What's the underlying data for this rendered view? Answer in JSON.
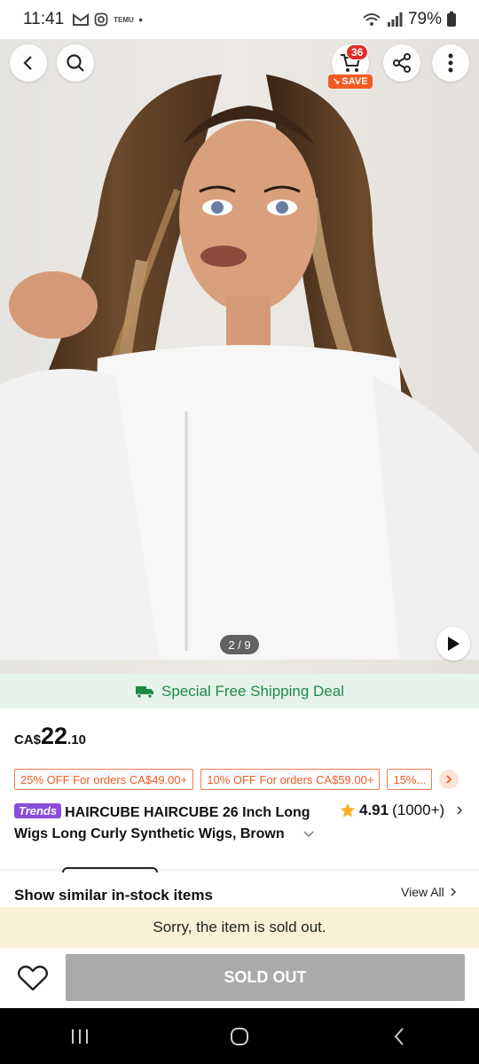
{
  "status_bar": {
    "time": "11:41",
    "battery": "79%",
    "notif_icons": [
      "gmail-icon",
      "instagram-icon",
      "temu-icon"
    ],
    "temu_label": "TEMU"
  },
  "header": {
    "cart_count": "36",
    "save_label": "SAVE"
  },
  "gallery": {
    "page_indicator": "2 / 9"
  },
  "shipping_banner": {
    "text": "Special Free Shipping Deal"
  },
  "price": {
    "currency": "CA$",
    "integer": "22",
    "decimal": ".10"
  },
  "coupons": [
    "25% OFF For orders CA$49.00+",
    "10% OFF For orders CA$59.00+",
    "15%..."
  ],
  "product": {
    "badge": "Trends",
    "title_line1": "HAIRCUBE HAIRCUBE 26 Inch Long",
    "title_line2": "Wigs Long Curly Synthetic Wigs, Brown"
  },
  "rating": {
    "score": "4.91",
    "count": "(1000+)"
  },
  "similar": {
    "heading": "Show similar in-stock items",
    "view_all": "View All"
  },
  "notice": {
    "text": "Sorry, the item is sold out."
  },
  "bottom_bar": {
    "sold_out_label": "SOLD OUT"
  },
  "colors": {
    "accent_orange": "#f05a24",
    "shipping_green": "#1f8a45",
    "sold_out_gray": "#aaaaaa",
    "notice_bg": "#faf0d6",
    "trends_purple": "#8a4dd8"
  }
}
